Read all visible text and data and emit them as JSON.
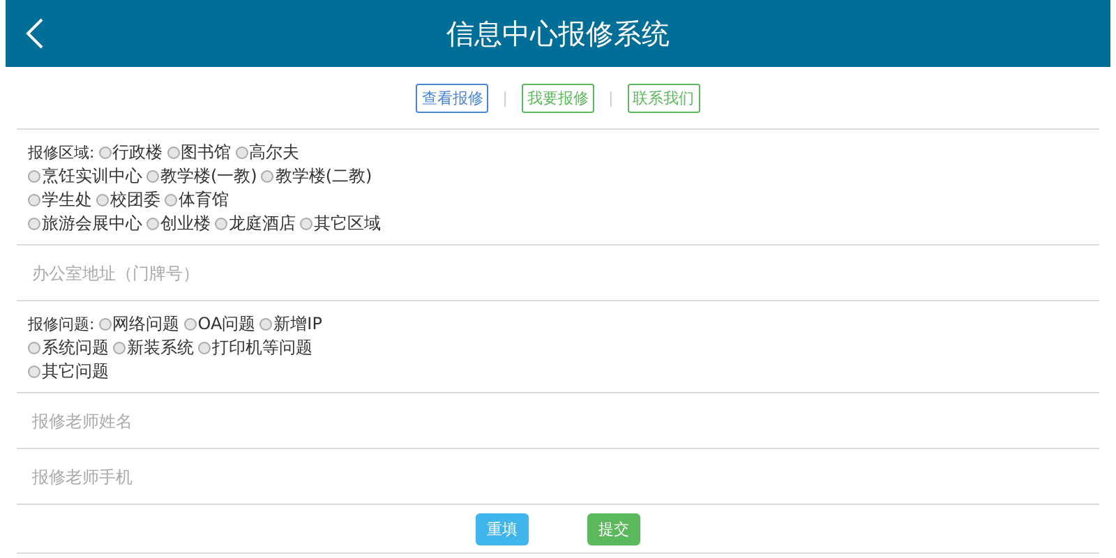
{
  "header": {
    "title": "信息中心报修系统"
  },
  "nav": [
    {
      "label": "查看报修",
      "color": "#4a86d8"
    },
    {
      "label": "我要报修",
      "color": "#5cb85c"
    },
    {
      "label": "联系我们",
      "color": "#5cb85c"
    }
  ],
  "nav_separator": "|",
  "area": {
    "label": "报修区域:",
    "lines": [
      [
        {
          "label": "行政楼",
          "selected": false
        },
        {
          "label": "图书馆",
          "selected": false
        },
        {
          "label": "高尔夫",
          "selected": false
        }
      ],
      [
        {
          "label": "烹饪实训中心",
          "selected": false
        },
        {
          "label": "教学楼(一教)",
          "selected": false
        },
        {
          "label": "教学楼(二教)",
          "selected": false
        }
      ],
      [
        {
          "label": "学生处",
          "selected": false
        },
        {
          "label": "校团委",
          "selected": false
        },
        {
          "label": "体育馆",
          "selected": false
        }
      ],
      [
        {
          "label": "旅游会展中心",
          "selected": false
        },
        {
          "label": "创业楼",
          "selected": false
        },
        {
          "label": "龙庭酒店",
          "selected": false
        },
        {
          "label": "其它区域",
          "selected": false
        }
      ]
    ]
  },
  "office": {
    "placeholder": "办公室地址（门牌号）"
  },
  "problem": {
    "label": "报修问题:",
    "lines": [
      [
        {
          "label": "网络问题",
          "selected": false
        },
        {
          "label": "OA问题",
          "selected": false
        },
        {
          "label": "新增IP",
          "selected": false
        }
      ],
      [
        {
          "label": "系统问题",
          "selected": false
        },
        {
          "label": "新装系统",
          "selected": false
        },
        {
          "label": "打印机等问题",
          "selected": false
        }
      ],
      [
        {
          "label": "其它问题",
          "selected": false
        }
      ]
    ]
  },
  "name": {
    "placeholder": "报修老师姓名"
  },
  "phone": {
    "placeholder": "报修老师手机"
  },
  "buttons": [
    {
      "label": "重填",
      "kind": "reset"
    },
    {
      "label": "提交",
      "kind": "submit"
    }
  ]
}
